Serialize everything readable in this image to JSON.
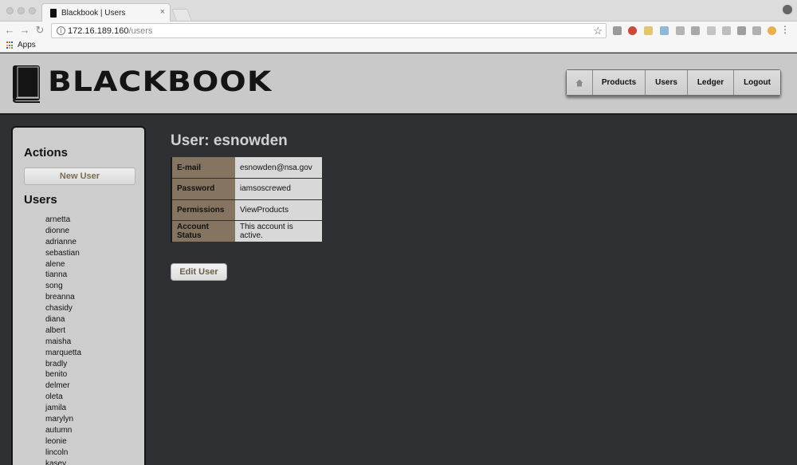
{
  "browser": {
    "tab_title": "Blackbook | Users",
    "tab_close": "×",
    "back_icon": "←",
    "forward_icon": "→",
    "reload_icon": "↻",
    "url_host": "172.16.189.160",
    "url_path": "/users",
    "info_icon": "i",
    "star_icon": "☆",
    "menu_icon": "⋮",
    "bookmarks_apps": "Apps"
  },
  "header": {
    "logo_text": "BLACKBOOK",
    "nav": [
      "Products",
      "Users",
      "Ledger",
      "Logout"
    ]
  },
  "sidebar": {
    "actions_heading": "Actions",
    "new_user_label": "New User",
    "users_heading": "Users",
    "users": [
      "arnetta",
      "dionne",
      "adrianne",
      "sebastian",
      "alene",
      "tianna",
      "song",
      "breanna",
      "chasidy",
      "diana",
      "albert",
      "maisha",
      "marquetta",
      "bradly",
      "benito",
      "delmer",
      "oleta",
      "jamila",
      "marylyn",
      "autumn",
      "leonie",
      "lincoln",
      "kasey"
    ]
  },
  "main": {
    "title": "User: esnowden",
    "details": [
      {
        "label": "E-mail",
        "value": "esnowden@nsa.gov"
      },
      {
        "label": "Password",
        "value": "iamsoscrewed"
      },
      {
        "label": "Permissions",
        "value": "ViewProducts"
      },
      {
        "label": "Account Status",
        "value": "This account is active."
      }
    ],
    "edit_label": "Edit User"
  },
  "colors": {
    "background": "#2e3034",
    "header": "#c9c9c9",
    "table_label": "#857560",
    "table_value": "#d8d8d8"
  }
}
